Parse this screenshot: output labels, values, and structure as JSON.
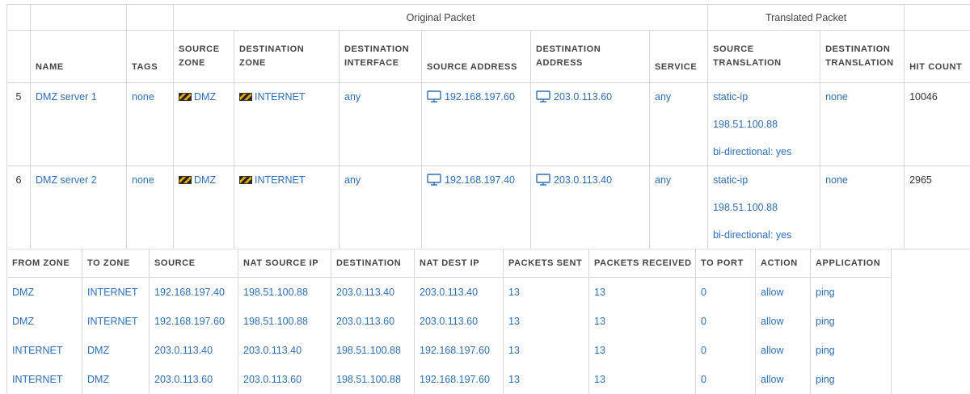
{
  "nat_rules": {
    "group_headers": {
      "original": "Original Packet",
      "translated": "Translated Packet"
    },
    "columns": {
      "name": "NAME",
      "tags": "TAGS",
      "source_zone": [
        "SOURCE",
        "ZONE"
      ],
      "destination_zone": [
        "DESTINATION",
        "ZONE"
      ],
      "destination_interface": [
        "DESTINATION",
        "INTERFACE"
      ],
      "source_address": "SOURCE ADDRESS",
      "destination_address": [
        "DESTINATION",
        "ADDRESS"
      ],
      "service": "SERVICE",
      "source_translation": [
        "SOURCE",
        "TRANSLATION"
      ],
      "destination_translation": [
        "DESTINATION",
        "TRANSLATION"
      ],
      "hit_count": "HIT COUNT"
    },
    "rows": [
      {
        "num": "5",
        "name": "DMZ server 1",
        "tags": "none",
        "source_zone": "DMZ",
        "destination_zone": "INTERNET",
        "destination_interface": "any",
        "source_address": "192.168.197.60",
        "destination_address": "203.0.113.60",
        "service": "any",
        "source_translation": [
          "static-ip",
          "198.51.100.88",
          "bi-directional: yes"
        ],
        "destination_translation": "none",
        "hit_count": "10046"
      },
      {
        "num": "6",
        "name": "DMZ server 2",
        "tags": "none",
        "source_zone": "DMZ",
        "destination_zone": "INTERNET",
        "destination_interface": "any",
        "source_address": "192.168.197.40",
        "destination_address": "203.0.113.40",
        "service": "any",
        "source_translation": [
          "static-ip",
          "198.51.100.88",
          "bi-directional: yes"
        ],
        "destination_translation": "none",
        "hit_count": "2965"
      }
    ]
  },
  "traffic_log": {
    "columns": [
      "FROM ZONE",
      "TO ZONE",
      "SOURCE",
      "NAT SOURCE IP",
      "DESTINATION",
      "NAT DEST IP",
      "PACKETS SENT",
      "PACKETS RECEIVED",
      "TO PORT",
      "ACTION",
      "APPLICATION"
    ],
    "rows": [
      [
        "DMZ",
        "INTERNET",
        "192.168.197.40",
        "198.51.100.88",
        "203.0.113.40",
        "203.0.113.40",
        "13",
        "13",
        "0",
        "allow",
        "ping"
      ],
      [
        "DMZ",
        "INTERNET",
        "192.168.197.60",
        "198.51.100.88",
        "203.0.113.60",
        "203.0.113.60",
        "13",
        "13",
        "0",
        "allow",
        "ping"
      ],
      [
        "INTERNET",
        "DMZ",
        "203.0.113.40",
        "203.0.113.40",
        "198.51.100.88",
        "192.168.197.60",
        "13",
        "13",
        "0",
        "allow",
        "ping"
      ],
      [
        "INTERNET",
        "DMZ",
        "203.0.113.60",
        "203.0.113.60",
        "198.51.100.88",
        "192.168.197.60",
        "13",
        "13",
        "0",
        "allow",
        "ping"
      ]
    ]
  },
  "icons": {
    "zone": "zone-icon",
    "address": "monitor-icon"
  },
  "colors": {
    "link": "#2c6fb7",
    "text": "#333333",
    "border": "#d6d6d6",
    "zone_icon": "#e6a400"
  }
}
